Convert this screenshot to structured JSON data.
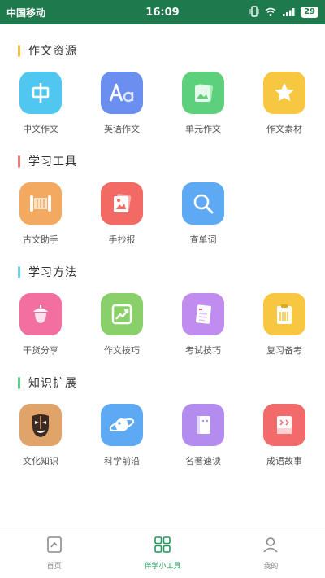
{
  "status": {
    "carrier": "中国移动",
    "time": "16:09",
    "battery": "29"
  },
  "sections": [
    {
      "title": "作文资源",
      "accent": "#f5c342",
      "items": [
        {
          "label": "中文作文",
          "icon": "zhong-char-icon",
          "color": "#4fc7f0"
        },
        {
          "label": "英语作文",
          "icon": "aa-letters-icon",
          "color": "#6b8ff0"
        },
        {
          "label": "单元作文",
          "icon": "image-card-icon",
          "color": "#5cd07a"
        },
        {
          "label": "作文素材",
          "icon": "star-icon",
          "color": "#f7c741"
        }
      ]
    },
    {
      "title": "学习工具",
      "accent": "#f07a7a",
      "items": [
        {
          "label": "古文助手",
          "icon": "scroll-icon",
          "color": "#f3a95f"
        },
        {
          "label": "手抄报",
          "icon": "picture-icon",
          "color": "#f26a63"
        },
        {
          "label": "查单词",
          "icon": "search-icon",
          "color": "#5ea9f3"
        }
      ]
    },
    {
      "title": "学习方法",
      "accent": "#6dd0ea",
      "items": [
        {
          "label": "干货分享",
          "icon": "acorn-icon",
          "color": "#f26fa0"
        },
        {
          "label": "作文技巧",
          "icon": "trend-chart-icon",
          "color": "#8ad06a"
        },
        {
          "label": "考试技巧",
          "icon": "exam-paper-icon",
          "color": "#c08cf0"
        },
        {
          "label": "复习备考",
          "icon": "clipboard-icon",
          "color": "#f7c741"
        }
      ]
    },
    {
      "title": "知识扩展",
      "accent": "#5cd08a",
      "items": [
        {
          "label": "文化知识",
          "icon": "opera-mask-icon",
          "color": "#e0a36a"
        },
        {
          "label": "科学前沿",
          "icon": "planet-icon",
          "color": "#5ea9f3"
        },
        {
          "label": "名著速读",
          "icon": "book-icon",
          "color": "#b48cf0"
        },
        {
          "label": "成语故事",
          "icon": "story-book-icon",
          "color": "#f26a6a"
        }
      ]
    }
  ],
  "tabs": [
    {
      "label": "首页",
      "icon": "home-doc-icon",
      "active": false
    },
    {
      "label": "伴学小工具",
      "icon": "grid-tools-icon",
      "active": true
    },
    {
      "label": "我的",
      "icon": "profile-icon",
      "active": false
    }
  ]
}
